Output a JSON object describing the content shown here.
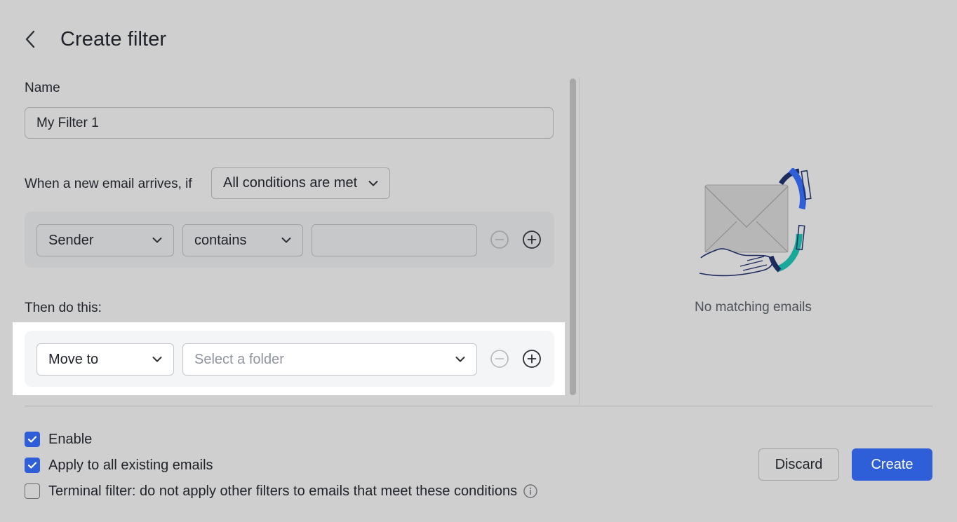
{
  "header": {
    "title": "Create filter"
  },
  "name_section": {
    "label": "Name",
    "value": "My Filter 1"
  },
  "condition_section": {
    "prefix": "When a new email arrives, if",
    "match_mode": "All conditions are met",
    "row": {
      "field": "Sender",
      "operator": "contains",
      "value": ""
    }
  },
  "action_section": {
    "label": "Then do this:",
    "row": {
      "action": "Move to",
      "folder_placeholder": "Select a folder"
    }
  },
  "preview": {
    "empty_text": "No matching emails"
  },
  "options": {
    "enable": {
      "label": "Enable",
      "checked": true
    },
    "apply_existing": {
      "label": "Apply to all existing emails",
      "checked": true
    },
    "terminal": {
      "label": "Terminal filter: do not apply other filters to emails that meet these conditions",
      "checked": false
    }
  },
  "footer": {
    "discard_label": "Discard",
    "create_label": "Create"
  },
  "colors": {
    "accent": "#2f5fd8",
    "background": "#cfcfcf",
    "teal": "#1aa89a",
    "navy": "#1b2b5e"
  },
  "icons": [
    "back-arrow-icon",
    "chevron-down-icon",
    "remove-circle-icon",
    "add-circle-icon",
    "checkmark-icon",
    "info-icon",
    "envelope-illustration"
  ]
}
